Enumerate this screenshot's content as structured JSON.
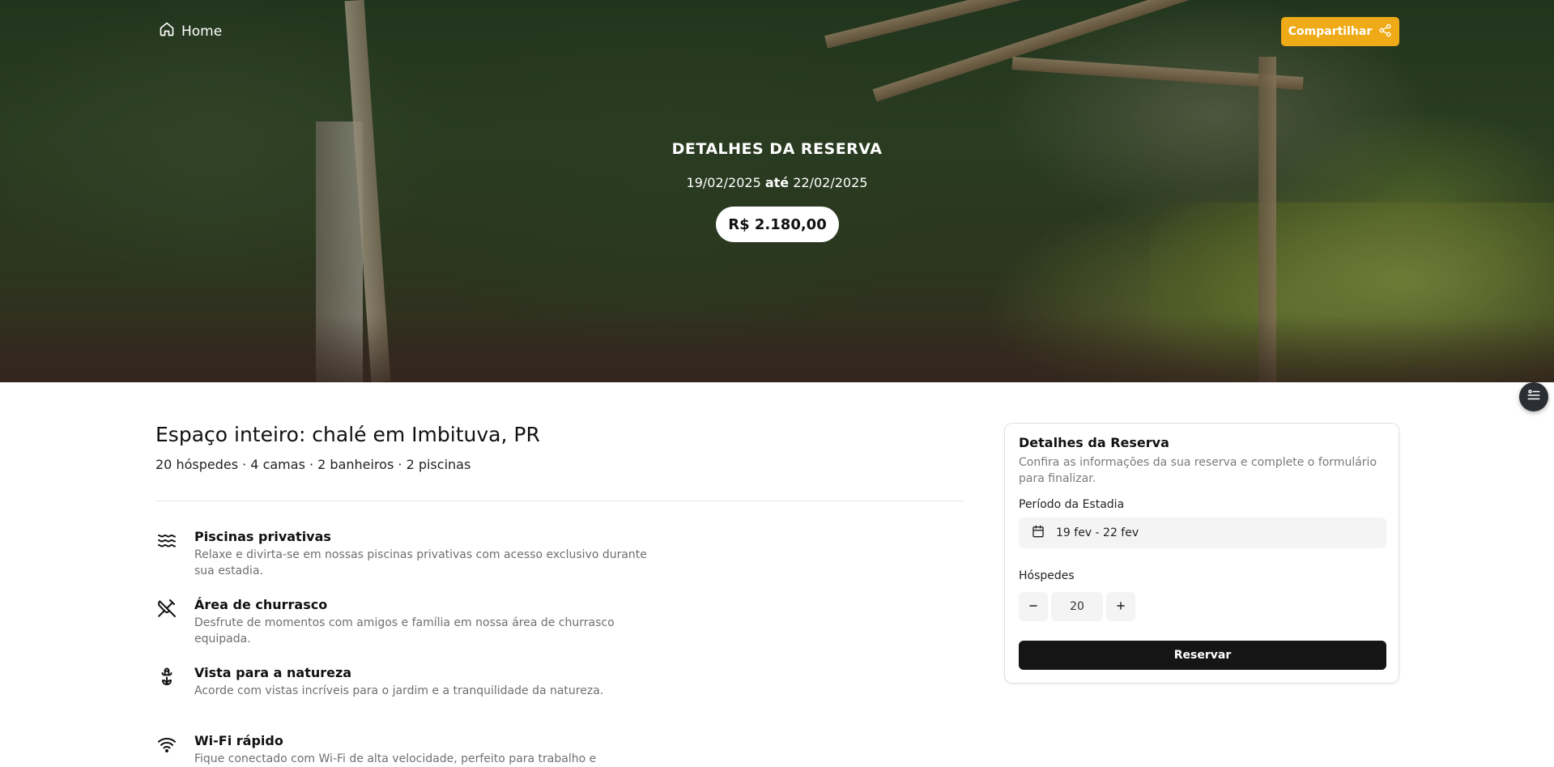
{
  "header": {
    "home_label": "Home",
    "share_label": "Compartilhar",
    "accent_color": "#efaa17"
  },
  "hero": {
    "title": "DETALHES DA RESERVA",
    "date_from": "19/02/2025",
    "date_sep": "até",
    "date_to": "22/02/2025",
    "price": "R$ 2.180,00"
  },
  "listing": {
    "title": "Espaço inteiro: chalé em Imbituva, PR",
    "subtitle": "20 hóspedes · 4 camas · 2 banheiros · 2 piscinas"
  },
  "amenities": [
    {
      "icon": "waves-icon",
      "title": "Piscinas privativas",
      "description": "Relaxe e divirta-se em nossas piscinas privativas com acesso exclusivo durante sua estadia."
    },
    {
      "icon": "utensils-crossed-icon",
      "title": "Área de churrasco",
      "description": "Desfrute de momentos com amigos e família em nossa área de churrasco equipada."
    },
    {
      "icon": "flower-icon",
      "title": "Vista para a natureza",
      "description": "Acorde com vistas incríveis para o jardim e a tranquilidade da natureza."
    },
    {
      "icon": "wifi-icon",
      "title": "Wi-Fi rápido",
      "description": "Fique conectado com Wi-Fi de alta velocidade, perfeito para trabalho e"
    }
  ],
  "booking_card": {
    "title": "Detalhes da Reserva",
    "description": "Confira as informações da sua reserva e complete o formulário para finalizar.",
    "period_label": "Período da Estadia",
    "period_value": "19 fev - 22 fev",
    "guests_label": "Hóspedes",
    "guests_value": "20",
    "reserve_label": "Reservar"
  }
}
